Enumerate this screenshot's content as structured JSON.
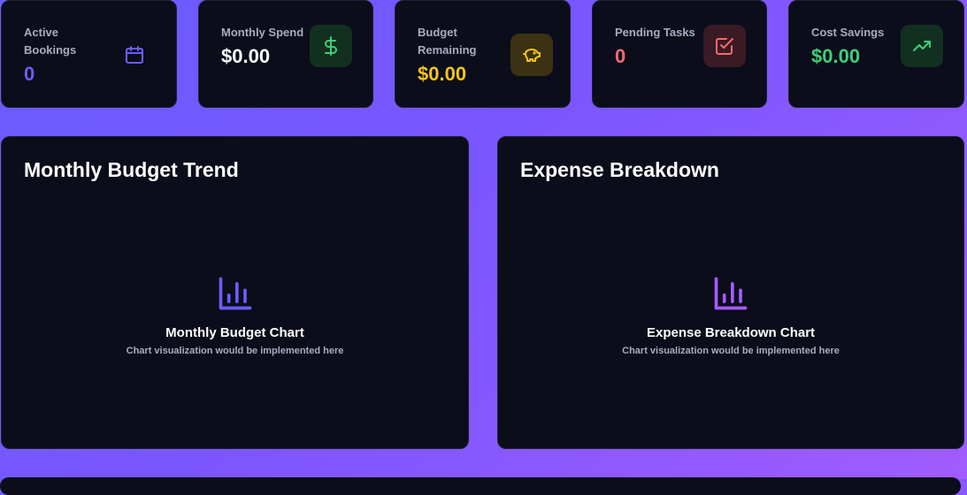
{
  "stats": [
    {
      "label": "Active Bookings",
      "value": "0",
      "value_color": "#6c5cff",
      "icon": "calendar-icon",
      "icon_color": "#6c5cff"
    },
    {
      "label": "Monthly Spend",
      "value": "$0.00",
      "value_color": "#ffffff",
      "icon": "dollar-icon",
      "icon_color": "#3ecf7a",
      "icon_bg": "#12301f"
    },
    {
      "label": "Budget Remaining",
      "value": "$0.00",
      "value_color": "#f5c518",
      "icon": "piggy-bank-icon",
      "icon_color": "#f5c518",
      "icon_bg": "#3a3212"
    },
    {
      "label": "Pending Tasks",
      "value": "0",
      "value_color": "#f26b6b",
      "icon": "checkbox-icon",
      "icon_color": "#f26b6b",
      "icon_bg": "#3a1a24"
    },
    {
      "label": "Cost Savings",
      "value": "$0.00",
      "value_color": "#3ecf7a",
      "icon": "trending-up-icon",
      "icon_color": "#3ecf7a",
      "icon_bg": "#12301f"
    }
  ],
  "panels": [
    {
      "title": "Monthly Budget Trend",
      "chart_title": "Monthly Budget Chart",
      "chart_subtitle": "Chart visualization would be implemented here",
      "icon": "bar-chart-icon",
      "icon_color": "#6c5cff"
    },
    {
      "title": "Expense Breakdown",
      "chart_title": "Expense Breakdown Chart",
      "chart_subtitle": "Chart visualization would be implemented here",
      "icon": "bar-chart-icon",
      "icon_color": "#a55cff"
    }
  ]
}
